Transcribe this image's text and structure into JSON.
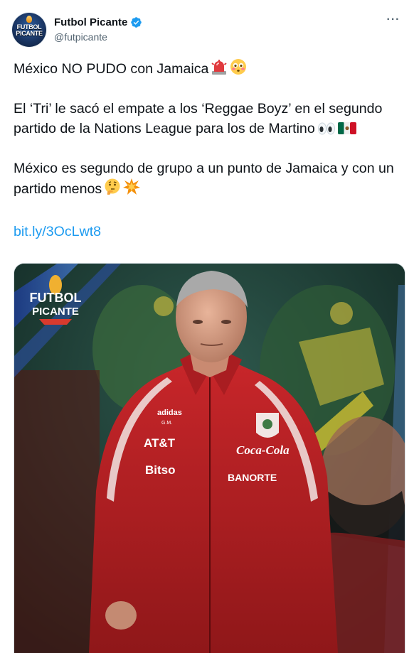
{
  "header": {
    "display_name": "Futbol Picante",
    "handle": "@futpicante",
    "avatar_text_line1": "FUTBOL",
    "avatar_text_line2": "PICANTE",
    "more_label": "···",
    "verified_color": "#1d9bf0"
  },
  "tweet": {
    "line1": "México NO PUDO con Jamaica",
    "line1_emojis": [
      "siren-emoji",
      "flushed-face-emoji"
    ],
    "para2": "El ‘Tri’ le sacó el empate a los ‘Reggae Boyz’ en el segundo partido de la Nations League para los de Martino",
    "para2_emojis": [
      "eyes-emoji",
      "mexico-flag-emoji"
    ],
    "para3": "México es segundo de grupo a un punto de Jamaica y con un partido menos",
    "para3_emojis": [
      "thinking-face-emoji",
      "collision-emoji"
    ],
    "link": "bit.ly/3OcLwt8",
    "link_color": "#1d9bf0"
  },
  "media": {
    "watermark_line1": "FUTBOL",
    "watermark_line2": "PICANTE",
    "jacket_sponsors": [
      "adidas",
      "AT&T",
      "Bitso",
      "Coca-Cola",
      "BANORTE"
    ],
    "jacket_initials": "G.M."
  }
}
